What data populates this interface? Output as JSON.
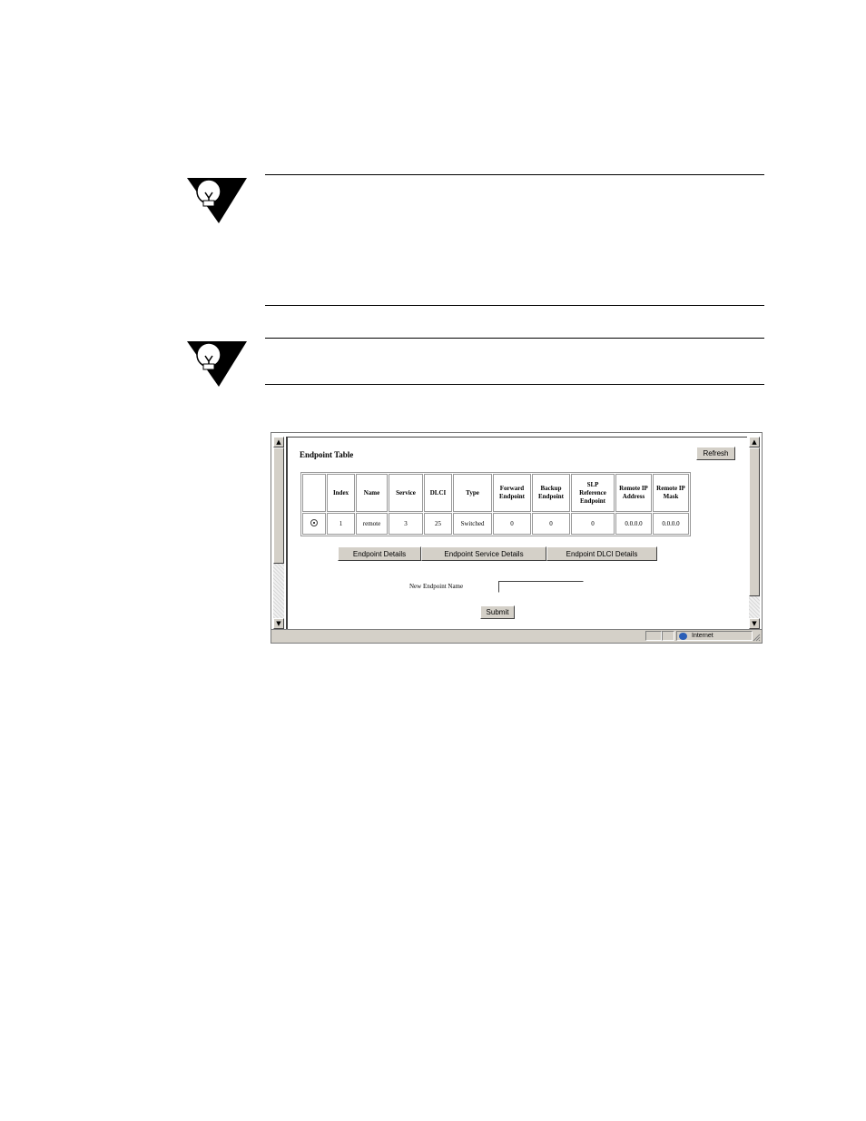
{
  "endpoint_table": {
    "title": "Endpoint Table",
    "refresh_label": "Refresh",
    "columns": [
      "",
      "Index",
      "Name",
      "Service",
      "DLCI",
      "Type",
      "Forward Endpoint",
      "Backup Endpoint",
      "SLP Reference Endpoint",
      "Remote IP Address",
      "Remote IP Mask"
    ],
    "rows": [
      {
        "index": "1",
        "name": "remote",
        "service": "3",
        "dlci": "25",
        "type": "Switched",
        "forward": "0",
        "backup": "0",
        "slp": "0",
        "remote_ip": "0.0.0.0",
        "remote_mask": "0.0.0.0"
      }
    ],
    "detail_buttons": [
      "Endpoint Details",
      "Endpoint Service Details",
      "Endpoint DLCI Details"
    ],
    "new_name_label": "New Endpoint Name",
    "new_name_value": "",
    "submit_label": "Submit"
  },
  "status_bar": {
    "zone": "Internet"
  },
  "icons": [
    "lightbulb-note-icon",
    "scroll-up-arrow-icon",
    "scroll-down-arrow-icon",
    "globe-icon"
  ]
}
